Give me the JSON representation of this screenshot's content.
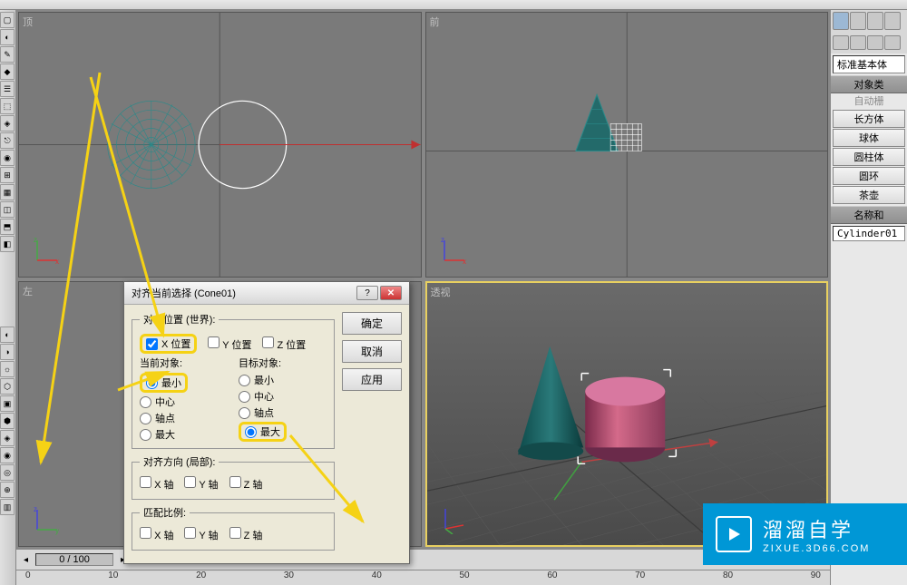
{
  "viewports": {
    "top": "顶",
    "front": "前",
    "left": "左",
    "perspective": "透视"
  },
  "dialog": {
    "title": "对齐当前选择 (Cone01)",
    "ok": "确定",
    "cancel": "取消",
    "apply": "应用",
    "group_align_pos": "对齐位置 (世界):",
    "xpos": "X 位置",
    "ypos": "Y 位置",
    "zpos": "Z 位置",
    "current_obj": "当前对象:",
    "target_obj": "目标对象:",
    "opt_min": "最小",
    "opt_center": "中心",
    "opt_pivot": "轴点",
    "opt_max": "最大",
    "group_orient": "对齐方向 (局部):",
    "group_scale": "匹配比例:",
    "xaxis": "X 轴",
    "yaxis": "Y 轴",
    "zaxis": "Z 轴"
  },
  "right_panel": {
    "dropdown": "标准基本体",
    "rollout_obj_type": "对象类",
    "auto_grid": "自动栅",
    "btn_box": "长方体",
    "btn_sphere": "球体",
    "btn_cylinder": "圆柱体",
    "btn_torus": "圆环",
    "btn_teapot": "茶壶",
    "rollout_name": "名称和",
    "name_value": "Cylinder01"
  },
  "bottom": {
    "frame": "0 / 100",
    "ticks": [
      "0",
      "10",
      "20",
      "30",
      "40",
      "50",
      "60",
      "70",
      "80",
      "90"
    ]
  },
  "watermark": {
    "big": "溜溜自学",
    "small": "ZIXUE.3D66.COM"
  }
}
